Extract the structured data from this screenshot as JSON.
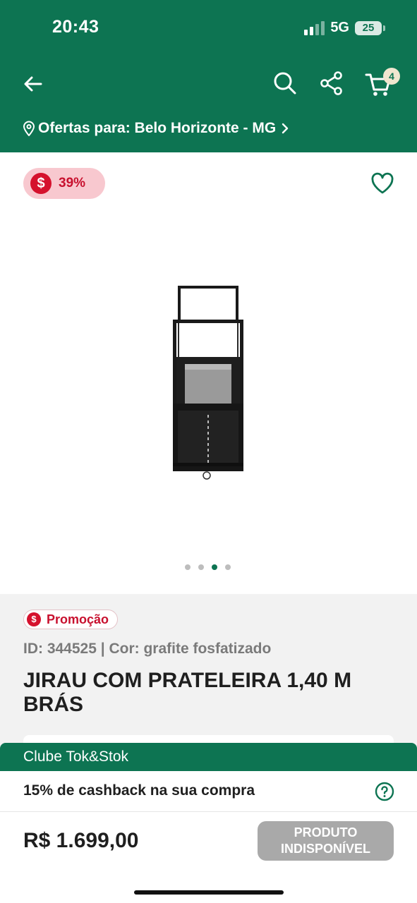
{
  "status_bar": {
    "time": "20:43",
    "network": "5G",
    "battery": "25"
  },
  "header": {
    "cart_count": "4",
    "location_text": "Ofertas para: Belo Horizonte - MG"
  },
  "product_image": {
    "discount_badge": "39%",
    "carousel": {
      "total": 4,
      "active_index": 3
    }
  },
  "product_info": {
    "promo_tag": "Promoção",
    "meta": "ID: 344525 | Cor: grafite fosfatizado",
    "title": "JIRAU COM PRATELEIRA 1,40 M BRÁS"
  },
  "club": {
    "title": "Clube Tok&Stok",
    "cashback_text": "15% de cashback na sua compra"
  },
  "purchase": {
    "price": "R$ 1.699,00",
    "button_label_line1": "PRODUTO",
    "button_label_line2": "INDISPONÍVEL"
  },
  "colors": {
    "brand_green": "#0d7452",
    "promo_red": "#c8102e",
    "disabled_gray": "#a9a9a9"
  }
}
